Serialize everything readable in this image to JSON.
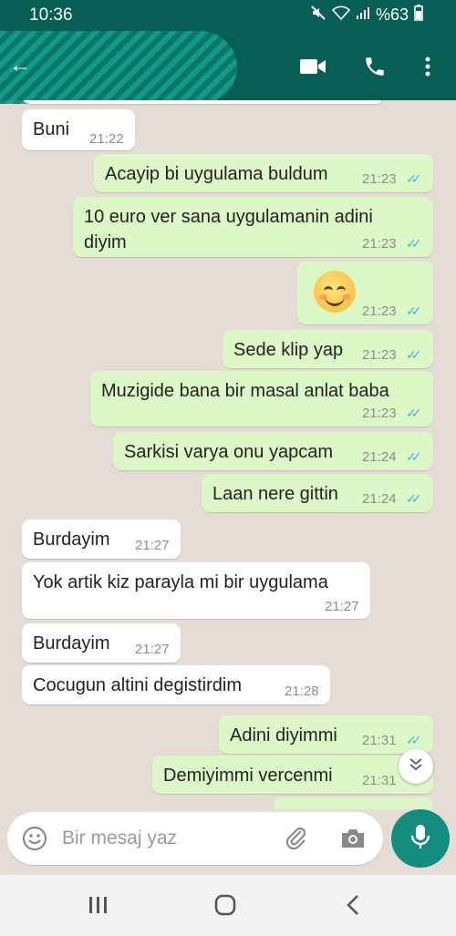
{
  "status": {
    "time": "10:36",
    "battery": "%63"
  },
  "header": {
    "contact_name": ""
  },
  "messages": [
    {
      "dir": "in",
      "text": "Buni",
      "time": "21:22"
    },
    {
      "dir": "out",
      "text": "Acayip bi uygulama buldum",
      "time": "21:23"
    },
    {
      "dir": "out",
      "text": "10 euro ver sana uygulamanin adini\ndiyim",
      "time": "21:23"
    },
    {
      "dir": "out",
      "text": "",
      "emoji": "smiling-face-emoji",
      "time": "21:23"
    },
    {
      "dir": "out",
      "text": "Sede klip yap",
      "time": "21:23"
    },
    {
      "dir": "out",
      "text": "Muzigide bana bir masal anlat baba",
      "time": "21:23"
    },
    {
      "dir": "out",
      "text": "Sarkisi varya onu yapcam",
      "time": "21:24"
    },
    {
      "dir": "out",
      "text": "Laan nere gittin",
      "time": "21:24"
    },
    {
      "dir": "in",
      "text": "Burdayim",
      "time": "21:27"
    },
    {
      "dir": "in",
      "text": "Yok artik kiz parayla mi bir uygulama",
      "time": "21:27"
    },
    {
      "dir": "in",
      "text": "Burdayim",
      "time": "21:27"
    },
    {
      "dir": "in",
      "text": "Cocugun altini degistirdim",
      "time": "21:28"
    },
    {
      "dir": "out",
      "text": "Adini diyimmi",
      "time": "21:31"
    },
    {
      "dir": "out",
      "text": "Demiyimmi vercenmi",
      "time": "21:31"
    }
  ],
  "composer": {
    "placeholder": "Bir mesaj yaz"
  },
  "colors": {
    "header": "#075e54",
    "outgoing": "#dcf8c6",
    "incoming": "#ffffff",
    "read_ticks": "#34b7f1",
    "fab": "#128c7e"
  },
  "icons": [
    "video-call-icon",
    "phone-icon",
    "more-icon",
    "emoji-icon",
    "attach-icon",
    "camera-icon",
    "mic-icon",
    "scroll-down-icon",
    "nav-recents-icon",
    "nav-home-icon",
    "nav-back-icon"
  ]
}
